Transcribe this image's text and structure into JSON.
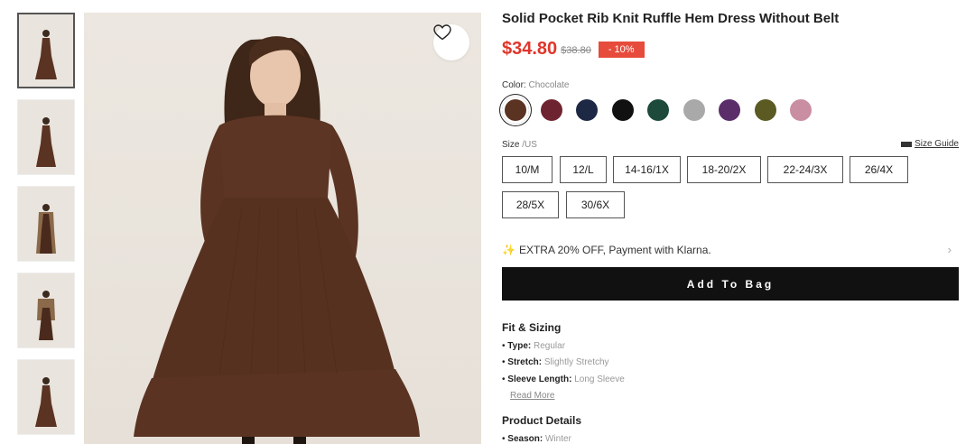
{
  "product": {
    "title": "Solid Pocket Rib Knit Ruffle Hem Dress Without Belt",
    "price": "$34.80",
    "old_price": "$38.80",
    "discount": "- 10%"
  },
  "color": {
    "label": "Color:",
    "selected": "Chocolate",
    "swatches": [
      {
        "name": "chocolate",
        "hex": "#5a3322"
      },
      {
        "name": "burgundy",
        "hex": "#6e2430"
      },
      {
        "name": "navy",
        "hex": "#1d2845"
      },
      {
        "name": "black",
        "hex": "#111111"
      },
      {
        "name": "dark-green",
        "hex": "#1d4a3a"
      },
      {
        "name": "grey",
        "hex": "#a9a9a9"
      },
      {
        "name": "purple",
        "hex": "#5b2e6a"
      },
      {
        "name": "olive",
        "hex": "#5a5a22"
      },
      {
        "name": "pink",
        "hex": "#c98ea2"
      }
    ]
  },
  "size": {
    "label": "Size",
    "unit": "/US",
    "guide": "Size Guide",
    "options": [
      "10/M",
      "12/L",
      "14-16/1X",
      "18-20/2X",
      "22-24/3X",
      "26/4X",
      "28/5X",
      "30/6X"
    ]
  },
  "promo": {
    "icon": "sparkle-icon",
    "text": "EXTRA 20% OFF, Payment with Klarna.",
    "chevron": "›"
  },
  "add_to_bag": "Add To Bag",
  "fit": {
    "title": "Fit & Sizing",
    "items": [
      {
        "key": "Type:",
        "value": "Regular"
      },
      {
        "key": "Stretch:",
        "value": "Slightly Stretchy"
      },
      {
        "key": "Sleeve Length:",
        "value": "Long Sleeve"
      }
    ],
    "read_more": "Read More"
  },
  "details": {
    "title": "Product Details",
    "items": [
      {
        "key": "Season:",
        "value": "Winter"
      }
    ]
  }
}
